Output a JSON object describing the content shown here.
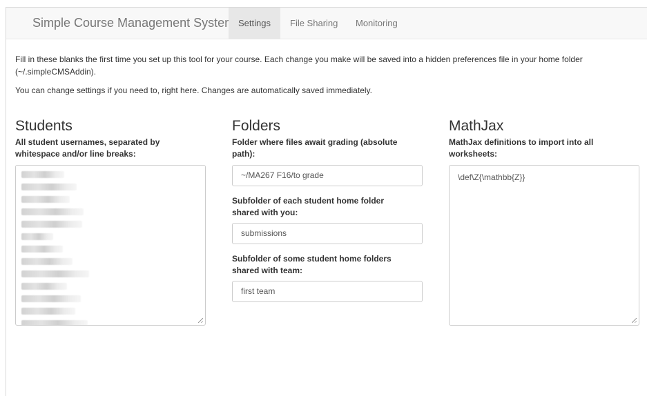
{
  "navbar": {
    "brand": "Simple Course Management System",
    "tabs": [
      {
        "label": "Settings",
        "active": true
      },
      {
        "label": "File Sharing",
        "active": false
      },
      {
        "label": "Monitoring",
        "active": false
      }
    ]
  },
  "intro": {
    "line1": "Fill in these blanks the first time you set up this tool for your course. Each change you make will be saved into a hidden preferences file in your home folder",
    "line1b": "(~/.simpleCMSAddin).",
    "line2": "You can change settings if you need to, right here. Changes are automatically saved immediately."
  },
  "students": {
    "heading": "Students",
    "label_line1": "All student usernames, separated by",
    "label_line2": "whitespace and/or line breaks:",
    "content_redacted": true
  },
  "folders": {
    "heading": "Folders",
    "grading_label_line1": "Folder where files await grading (absolute",
    "grading_label_line2": "path):",
    "grading_value": "~/MA267 F16/to grade",
    "submissions_label_line1": "Subfolder of each student home folder",
    "submissions_label_line2": "shared with you:",
    "submissions_value": "submissions",
    "team_label_line1": "Subfolder of some student home folders",
    "team_label_line2": "shared with team:",
    "team_value": "first team"
  },
  "mathjax": {
    "heading": "MathJax",
    "label_line1": "MathJax definitions to import into all",
    "label_line2": "worksheets:",
    "value": "\\def\\Z{\\mathbb{Z}}"
  },
  "colors": {
    "navbar_bg": "#f8f8f8",
    "active_tab_bg": "#e7e7e7",
    "muted_text": "#777777",
    "input_border": "#cccccc"
  }
}
